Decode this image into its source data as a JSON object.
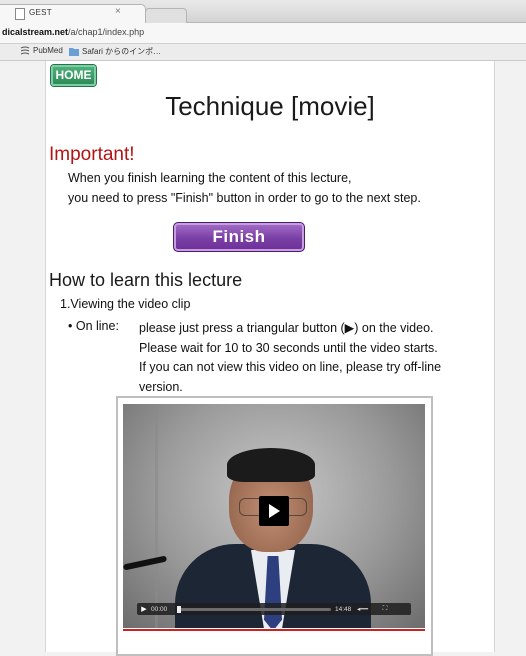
{
  "browser": {
    "tab_title": "GEST",
    "tab_close": "×",
    "url_prefix": "dicalstream.net",
    "url_path": "/a/chap1/index.php",
    "bookmarks": [
      {
        "label": "PubMed",
        "icon": "pubmed-icon"
      },
      {
        "label": "Safari からのインポ…",
        "icon": "folder-icon"
      }
    ]
  },
  "page": {
    "home_label": "HOME",
    "title": "Technique [movie]",
    "important_heading": "Important!",
    "important_line1": "When you finish learning the content of this lecture,",
    "important_line2": "you need to press \"Finish\" button in order to go to the next step.",
    "finish_label": "Finish",
    "howto_heading": "How to learn this lecture",
    "step1": "1.Viewing the video clip",
    "bullet_label": "• On line:",
    "bullet_lines": [
      "please just press a triangular button (▶) on the video.",
      "Please wait for 10 to 30 seconds until the video starts.",
      "If you can not view this video on line, please try off-line",
      "version."
    ]
  },
  "video": {
    "current_time": "00:00",
    "duration": "14:48",
    "progress": 0,
    "accent_color": "#cc2222"
  }
}
